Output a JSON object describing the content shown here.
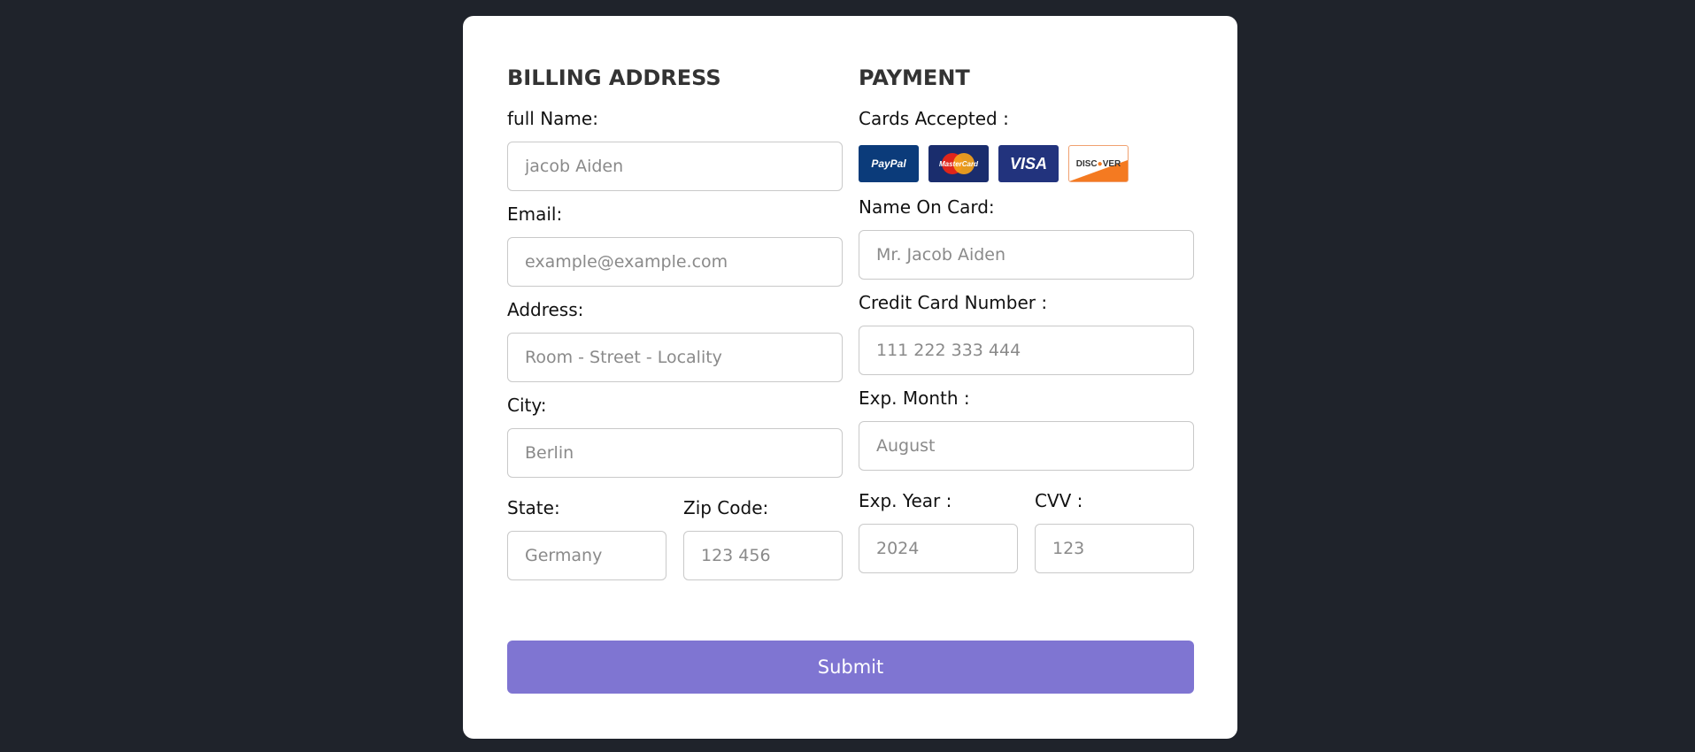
{
  "billing": {
    "heading": "BILLING ADDRESS",
    "full_name": {
      "label": "full Name:",
      "placeholder": "jacob Aiden"
    },
    "email": {
      "label": "Email:",
      "placeholder": "example@example.com"
    },
    "address": {
      "label": "Address:",
      "placeholder": "Room - Street - Locality"
    },
    "city": {
      "label": "City:",
      "placeholder": "Berlin"
    },
    "state": {
      "label": "State:",
      "placeholder": "Germany"
    },
    "zip": {
      "label": "Zip Code:",
      "placeholder": "123 456"
    }
  },
  "payment": {
    "heading": "PAYMENT",
    "cards_label": "Cards Accepted :",
    "cards": {
      "paypal": "PayPal",
      "mastercard": "MasterCard",
      "visa": "VISA",
      "discover_a": "DISC",
      "discover_dot": "●",
      "discover_b": "VER"
    },
    "name_on_card": {
      "label": "Name On Card:",
      "placeholder": "Mr. Jacob Aiden"
    },
    "card_number": {
      "label": "Credit Card Number :",
      "placeholder": "111 222 333 444"
    },
    "exp_month": {
      "label": "Exp. Month :",
      "placeholder": "August"
    },
    "exp_year": {
      "label": "Exp. Year :",
      "placeholder": "2024"
    },
    "cvv": {
      "label": "CVV :",
      "placeholder": "123"
    }
  },
  "submit_label": "Submit",
  "colors": {
    "background": "#1f232b",
    "card": "#ffffff",
    "submit": "#7f75d2"
  }
}
